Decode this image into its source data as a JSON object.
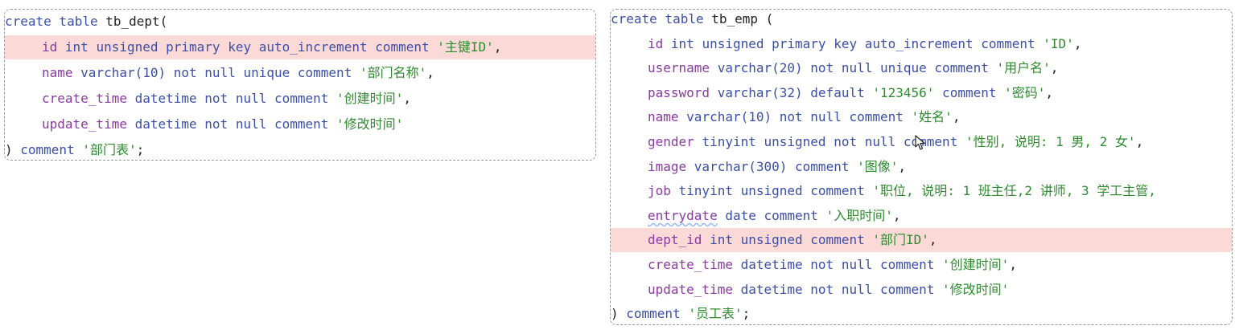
{
  "dept": {
    "header": [
      {
        "t": "create table ",
        "c": "kw"
      },
      {
        "t": "tb_dept(",
        "c": "plain"
      }
    ],
    "lines": [
      {
        "hl": true,
        "tokens": [
          {
            "t": "id ",
            "c": "col"
          },
          {
            "t": "int unsigned primary key auto_increment comment ",
            "c": "kw"
          },
          {
            "t": "'主键ID'",
            "c": "str"
          },
          {
            "t": ",",
            "c": "plain"
          }
        ]
      },
      {
        "hl": false,
        "tokens": [
          {
            "t": "name ",
            "c": "col"
          },
          {
            "t": "varchar(",
            "c": "kw"
          },
          {
            "t": "10",
            "c": "num"
          },
          {
            "t": ") not null unique comment ",
            "c": "kw"
          },
          {
            "t": "'部门名称'",
            "c": "str"
          },
          {
            "t": ",",
            "c": "plain"
          }
        ]
      },
      {
        "hl": false,
        "tokens": [
          {
            "t": "create_time ",
            "c": "col"
          },
          {
            "t": "datetime not null comment ",
            "c": "kw"
          },
          {
            "t": "'创建时间'",
            "c": "str"
          },
          {
            "t": ",",
            "c": "plain"
          }
        ]
      },
      {
        "hl": false,
        "tokens": [
          {
            "t": "update_time ",
            "c": "col"
          },
          {
            "t": "datetime not null comment ",
            "c": "kw"
          },
          {
            "t": "'修改时间'",
            "c": "str"
          }
        ]
      }
    ],
    "footer": [
      {
        "t": ") ",
        "c": "plain"
      },
      {
        "t": "comment ",
        "c": "kw"
      },
      {
        "t": "'部门表'",
        "c": "str"
      },
      {
        "t": ";",
        "c": "plain"
      }
    ]
  },
  "emp": {
    "header": [
      {
        "t": "create table ",
        "c": "kw"
      },
      {
        "t": "tb_emp (",
        "c": "plain"
      }
    ],
    "lines": [
      {
        "hl": false,
        "tokens": [
          {
            "t": "id ",
            "c": "col"
          },
          {
            "t": "int unsigned primary key auto_increment comment ",
            "c": "kw"
          },
          {
            "t": "'ID'",
            "c": "str"
          },
          {
            "t": ",",
            "c": "plain"
          }
        ]
      },
      {
        "hl": false,
        "tokens": [
          {
            "t": "username ",
            "c": "col"
          },
          {
            "t": "varchar(",
            "c": "kw"
          },
          {
            "t": "20",
            "c": "num"
          },
          {
            "t": ") not null unique comment ",
            "c": "kw"
          },
          {
            "t": "'用户名'",
            "c": "str"
          },
          {
            "t": ",",
            "c": "plain"
          }
        ]
      },
      {
        "hl": false,
        "tokens": [
          {
            "t": "password ",
            "c": "col"
          },
          {
            "t": "varchar(",
            "c": "kw"
          },
          {
            "t": "32",
            "c": "num"
          },
          {
            "t": ") default ",
            "c": "kw"
          },
          {
            "t": "'123456'",
            "c": "str"
          },
          {
            "t": " comment ",
            "c": "kw"
          },
          {
            "t": "'密码'",
            "c": "str"
          },
          {
            "t": ",",
            "c": "plain"
          }
        ]
      },
      {
        "hl": false,
        "tokens": [
          {
            "t": "name ",
            "c": "col"
          },
          {
            "t": "varchar(",
            "c": "kw"
          },
          {
            "t": "10",
            "c": "num"
          },
          {
            "t": ") not null comment ",
            "c": "kw"
          },
          {
            "t": "'姓名'",
            "c": "str"
          },
          {
            "t": ",",
            "c": "plain"
          }
        ]
      },
      {
        "hl": false,
        "tokens": [
          {
            "t": "gender ",
            "c": "col"
          },
          {
            "t": "tinyint unsigned not null comment ",
            "c": "kw"
          },
          {
            "t": "'性别, 说明: 1 男, 2 女'",
            "c": "str"
          },
          {
            "t": ",",
            "c": "plain"
          }
        ]
      },
      {
        "hl": false,
        "tokens": [
          {
            "t": "image ",
            "c": "col"
          },
          {
            "t": "varchar(",
            "c": "kw"
          },
          {
            "t": "300",
            "c": "num"
          },
          {
            "t": ") comment ",
            "c": "kw"
          },
          {
            "t": "'图像'",
            "c": "str"
          },
          {
            "t": ",",
            "c": "plain"
          }
        ]
      },
      {
        "hl": false,
        "tokens": [
          {
            "t": "job ",
            "c": "col"
          },
          {
            "t": "tinyint unsigned comment ",
            "c": "kw"
          },
          {
            "t": "'职位, 说明: 1 班主任,2 讲师, 3 学工主管,",
            "c": "str"
          }
        ]
      },
      {
        "hl": false,
        "tokens": [
          {
            "t": "entrydate",
            "c": "col sq"
          },
          {
            "t": " ",
            "c": "plain"
          },
          {
            "t": "date comment ",
            "c": "kw"
          },
          {
            "t": "'入职时间'",
            "c": "str"
          },
          {
            "t": ",",
            "c": "plain"
          }
        ]
      },
      {
        "hl": true,
        "tokens": [
          {
            "t": "dept_id ",
            "c": "col"
          },
          {
            "t": "int unsigned comment ",
            "c": "kw"
          },
          {
            "t": "'部门ID'",
            "c": "str"
          },
          {
            "t": ",",
            "c": "plain"
          }
        ]
      },
      {
        "hl": false,
        "tokens": [
          {
            "t": "create_time ",
            "c": "col"
          },
          {
            "t": "datetime not null comment ",
            "c": "kw"
          },
          {
            "t": "'创建时间'",
            "c": "str"
          },
          {
            "t": ",",
            "c": "plain"
          }
        ]
      },
      {
        "hl": false,
        "tokens": [
          {
            "t": "update_time ",
            "c": "col"
          },
          {
            "t": "datetime not null comment ",
            "c": "kw"
          },
          {
            "t": "'修改时间'",
            "c": "str"
          }
        ]
      }
    ],
    "footer": [
      {
        "t": ") ",
        "c": "plain"
      },
      {
        "t": "comment ",
        "c": "kw"
      },
      {
        "t": "'员工表'",
        "c": "str"
      },
      {
        "t": ";",
        "c": "plain"
      }
    ]
  },
  "icons": {
    "cursor": "text-cursor-icon"
  },
  "colors": {
    "keyword": "#3b4fa8",
    "column": "#8a3aa0",
    "string": "#2e8b2e",
    "highlight": "#fbd9d6"
  }
}
